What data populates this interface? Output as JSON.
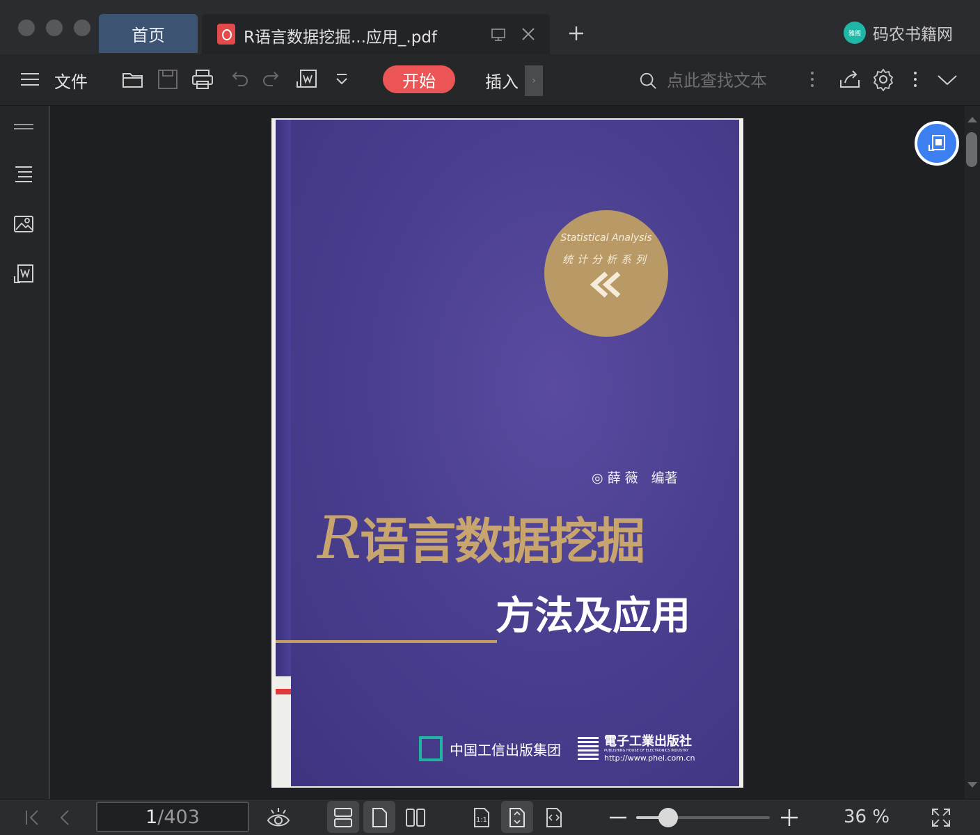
{
  "titlebar": {
    "tabs": [
      {
        "label": "首页"
      },
      {
        "label": "R语言数据挖掘...应用_.pdf"
      }
    ],
    "brand": "码农书籍网",
    "brand_badge": "雅阁"
  },
  "toolbar": {
    "menu_label": "文件",
    "start_label": "开始",
    "insert_label": "插入",
    "insert_more": "›",
    "search_placeholder": "点此查找文本"
  },
  "document": {
    "cover": {
      "series_en": "Statistical Analysis",
      "series_cn": "统计分析系列",
      "author": "◎ 薛 薇　编著",
      "title_r": "R",
      "title_rest": "语言数据挖掘",
      "subtitle": "方法及应用",
      "publisher1": "中国工信出版集团",
      "publisher2": "電子工業出版社",
      "publisher2_en": "PUBLISHING HOUSE OF ELECTRONICS INDUSTRY",
      "publisher2_url": "http://www.phei.com.cn"
    }
  },
  "statusbar": {
    "current_page": "1",
    "total_pages": "/403",
    "zoom": "36 %",
    "zoom_fraction": 0.24
  },
  "colors": {
    "accent_red": "#ec5555",
    "tab_active": "#3d5372",
    "float_button": "#3b7ff0"
  }
}
